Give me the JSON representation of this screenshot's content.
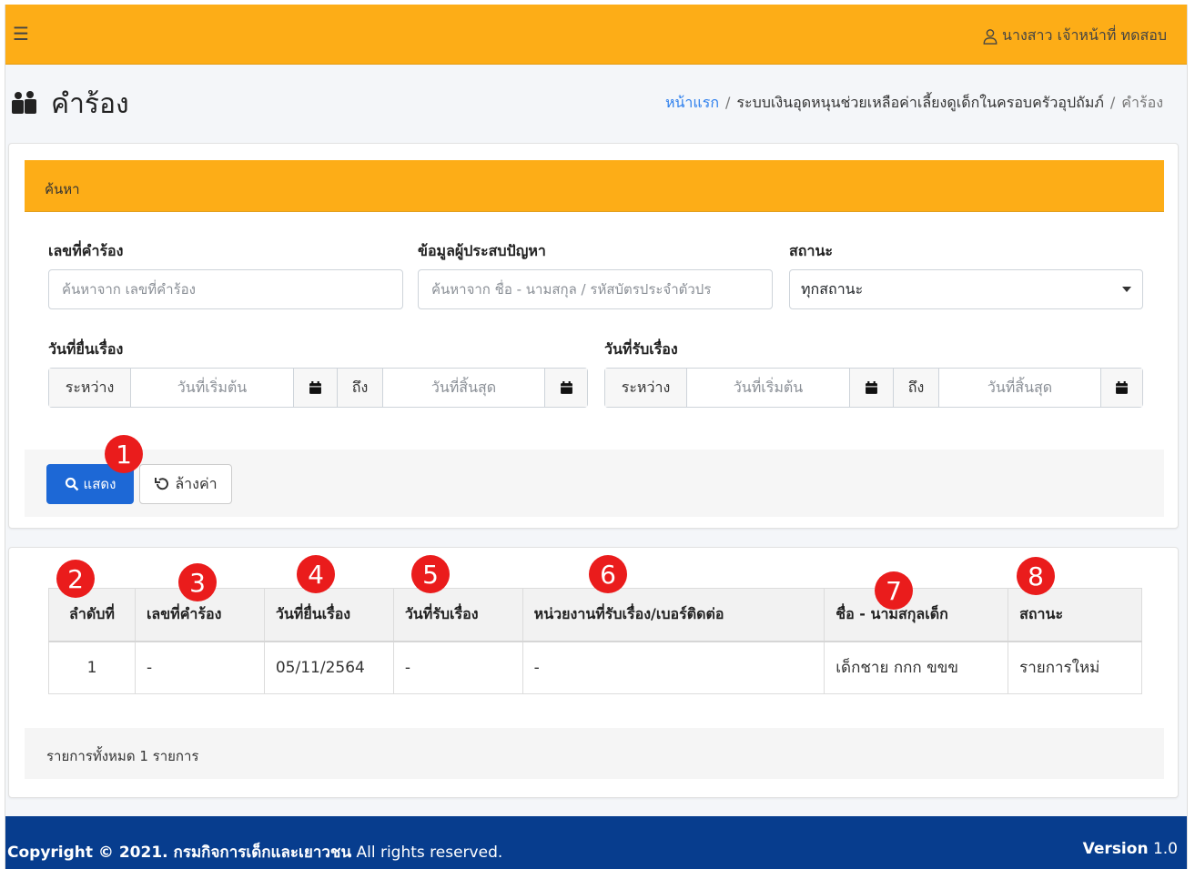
{
  "header": {
    "menu_icon": "hamburger-icon",
    "user_icon": "user-icon",
    "user_name": "นางสาว เจ้าหน้าที่ ทดสอบ"
  },
  "page": {
    "icon": "users-icon",
    "title": "คำร้อง",
    "breadcrumb": {
      "home": "หน้าแรก",
      "sep": "/",
      "section": "ระบบเงินอุดหนุนช่วยเหลือค่าเลี้ยงดูเด็กในครอบครัวอุปถัมภ์",
      "current": "คำร้อง"
    }
  },
  "search": {
    "heading": "ค้นหา",
    "request_no": {
      "label": "เลขที่คำร้อง",
      "placeholder": "ค้นหาจาก เลขที่คำร้อง",
      "value": ""
    },
    "victim_info": {
      "label": "ข้อมูลผู้ประสบปัญหา",
      "placeholder": "ค้นหาจาก ชื่อ - นามสกุล / รหัสบัตรประจำตัวปร",
      "value": ""
    },
    "status": {
      "label": "สถานะ",
      "value": "ทุกสถานะ"
    },
    "submit_date": {
      "label": "วันที่ยื่นเรื่อง",
      "between": "ระหว่าง",
      "start_placeholder": "วันที่เริ่มต้น",
      "to": "ถึง",
      "end_placeholder": "วันที่สิ้นสุด"
    },
    "receive_date": {
      "label": "วันที่รับเรื่อง",
      "between": "ระหว่าง",
      "start_placeholder": "วันที่เริ่มต้น",
      "to": "ถึง",
      "end_placeholder": "วันที่สิ้นสุด"
    },
    "show_button": "แสดง",
    "clear_button": "ล้างค่า"
  },
  "results": {
    "columns": [
      "ลำดับที่",
      "เลขที่คำร้อง",
      "วันที่ยื่นเรื่อง",
      "วันที่รับเรื่อง",
      "หน่วยงานที่รับเรื่อง/เบอร์ติดต่อ",
      "ชื่อ - นามสกุลเด็ก",
      "สถานะ"
    ],
    "rows": [
      [
        "1",
        "-",
        "05/11/2564",
        "-",
        "-",
        "เด็กชาย กกก ขขข",
        "รายการใหม่"
      ]
    ],
    "total": "รายการทั้งหมด 1 รายการ"
  },
  "annotations": [
    "1",
    "2",
    "3",
    "4",
    "5",
    "6",
    "7",
    "8"
  ],
  "footer": {
    "copyright_prefix": "Copyright © 2021. ",
    "org": "กรมกิจการเด็กและเยาวชน",
    "rights": " All rights reserved.",
    "version_label": "Version",
    "version": "1.0"
  },
  "colors": {
    "header_bg": "#fdad17",
    "primary": "#1d68d6",
    "link": "#2f80ed",
    "footer_bg": "#073d8e",
    "badge": "#ea1c1c"
  }
}
